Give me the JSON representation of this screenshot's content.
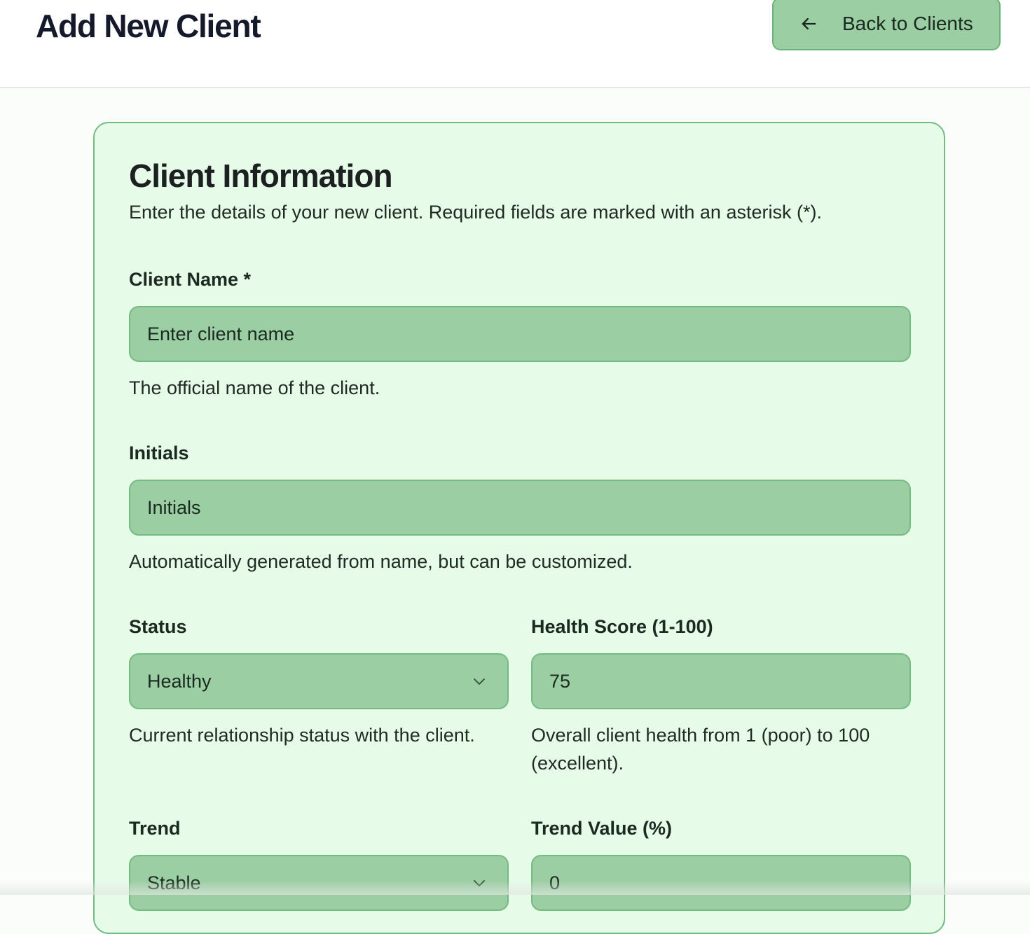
{
  "header": {
    "title": "Add New Client",
    "back_label": "Back to Clients"
  },
  "card": {
    "title": "Client Information",
    "description": "Enter the details of your new client. Required fields are marked with an asterisk (*)."
  },
  "fields": {
    "client_name": {
      "label": "Client Name *",
      "placeholder": "Enter client name",
      "help": "The official name of the client."
    },
    "initials": {
      "label": "Initials",
      "placeholder": "Initials",
      "help": "Automatically generated from name, but can be customized."
    },
    "status": {
      "label": "Status",
      "value": "Healthy",
      "help": "Current relationship status with the client."
    },
    "health_score": {
      "label": "Health Score (1-100)",
      "value": "75",
      "help": "Overall client health from 1 (poor) to 100 (excellent)."
    },
    "trend": {
      "label": "Trend",
      "value": "Stable"
    },
    "trend_value": {
      "label": "Trend Value (%)",
      "value": "0"
    }
  },
  "icons": {
    "back": "arrow-left-icon",
    "dropdown": "chevron-down-icon"
  },
  "colors": {
    "accent_fill": "#9bcea3",
    "accent_border": "#74bb82",
    "card_background": "#e6fbe8"
  }
}
